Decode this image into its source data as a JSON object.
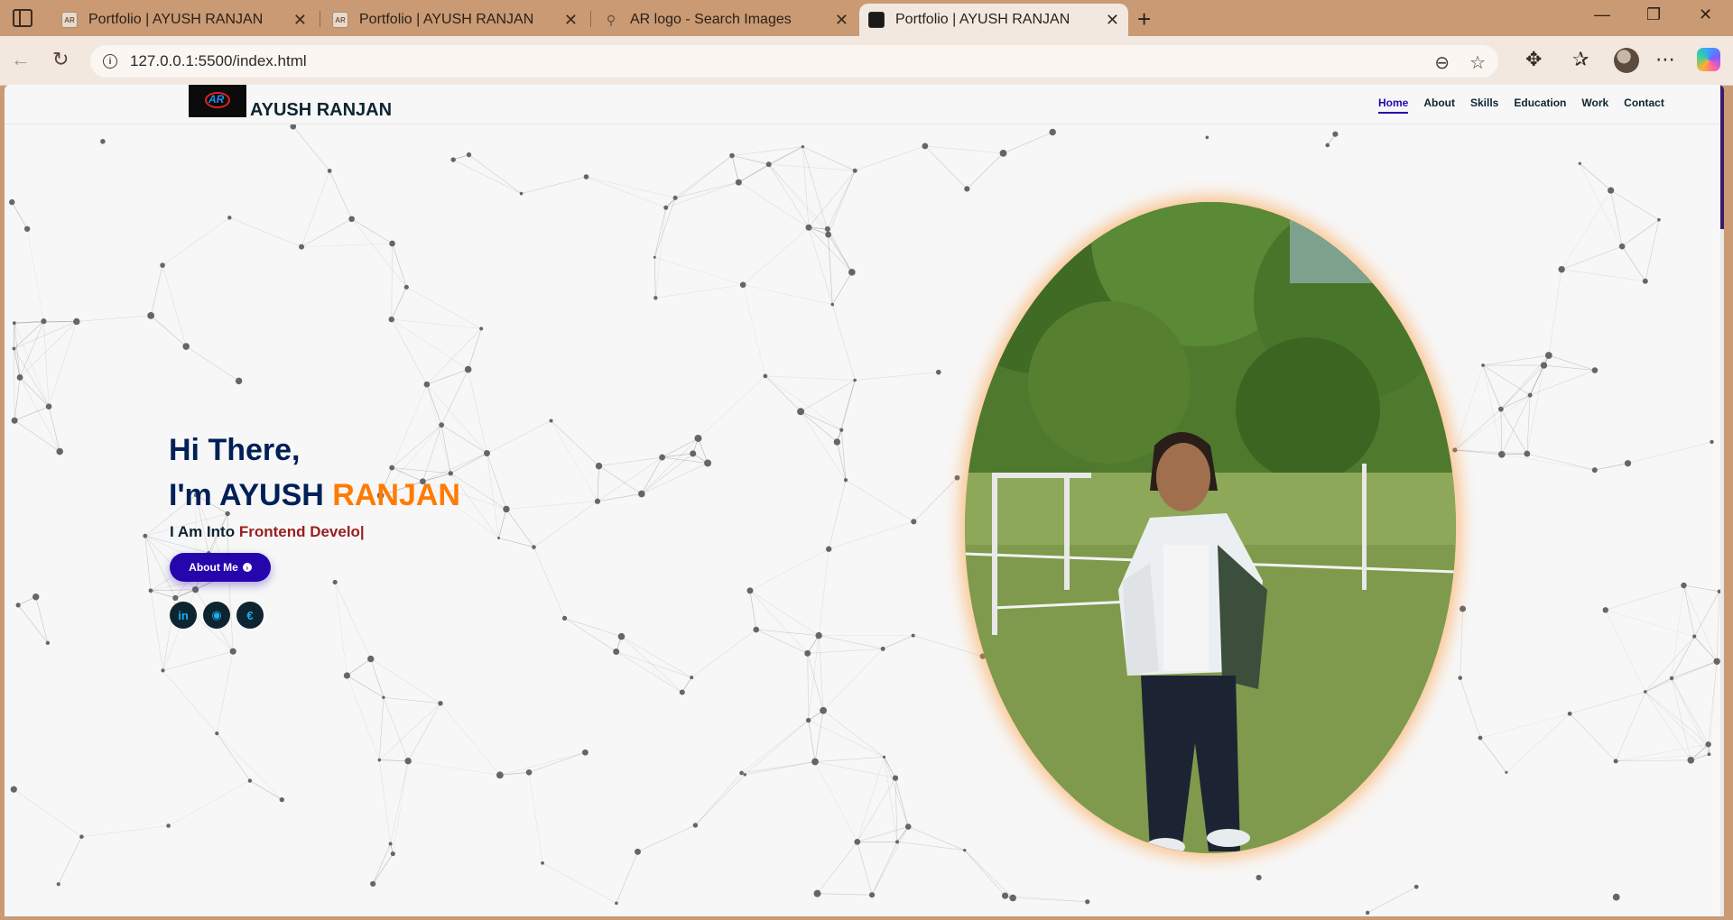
{
  "browser": {
    "tabs": [
      {
        "title": "Portfolio | AYUSH RANJAN",
        "favicon": "ar-logo-icon",
        "active": false
      },
      {
        "title": "Portfolio | AYUSH RANJAN",
        "favicon": "ar-logo-icon",
        "active": false
      },
      {
        "title": "AR logo - Search Images",
        "favicon": "search-icon",
        "active": false
      },
      {
        "title": "Portfolio | AYUSH RANJAN",
        "favicon": "ar-logo-icon",
        "active": true
      }
    ],
    "url": "127.0.0.1:5500/index.html"
  },
  "site": {
    "logo_text": "AR",
    "brand": "AYUSH RANJAN",
    "nav": [
      {
        "label": "Home",
        "active": true
      },
      {
        "label": "About",
        "active": false
      },
      {
        "label": "Skills",
        "active": false
      },
      {
        "label": "Education",
        "active": false
      },
      {
        "label": "Work",
        "active": false
      },
      {
        "label": "Contact",
        "active": false
      }
    ]
  },
  "hero": {
    "greeting": "Hi There,",
    "intro_prefix": "I'm AYUSH ",
    "intro_accent": "RANJAN",
    "into_prefix": "I Am Into ",
    "typed_text": "Frontend Develo|",
    "about_button": "About Me",
    "socials": [
      "linkedin-icon",
      "github-icon",
      "dev-icon"
    ]
  },
  "colors": {
    "primary": "#2506ad",
    "heading": "#002057",
    "accent": "#ff7b00",
    "typed": "#991e1e",
    "chrome": "#c99a73"
  }
}
